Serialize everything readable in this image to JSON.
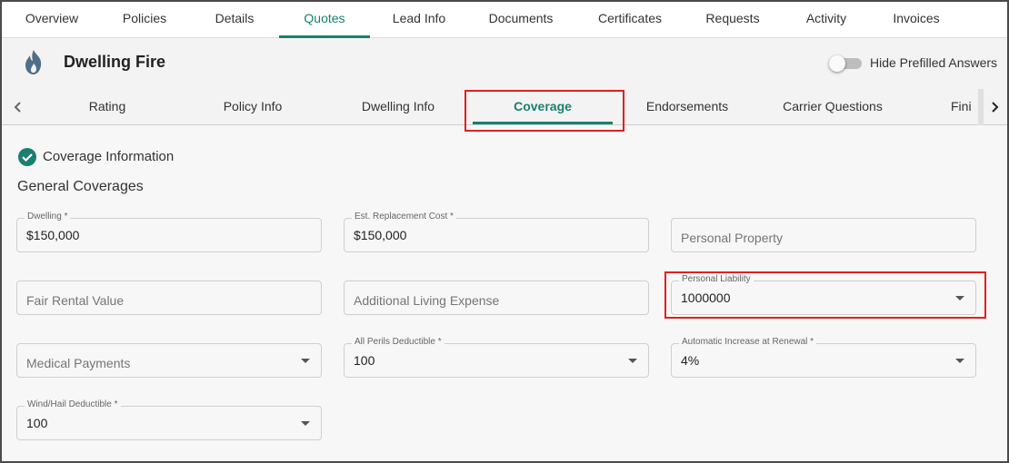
{
  "topnav": {
    "items": [
      "Overview",
      "Policies",
      "Details",
      "Quotes",
      "Lead Info",
      "Documents",
      "Certificates",
      "Requests",
      "Activity",
      "Invoices"
    ],
    "active_index": 3
  },
  "header": {
    "title": "Dwelling Fire",
    "logo_icon": "flame-icon",
    "toggle_label": "Hide Prefilled Answers",
    "toggle_on": false
  },
  "subtabs": {
    "items": [
      "Rating",
      "Policy Info",
      "Dwelling Info",
      "Coverage",
      "Endorsements",
      "Carrier Questions",
      "Fini"
    ],
    "active_index": 3,
    "prev_icon": "chevron-left-icon",
    "next_icon": "chevron-right-icon"
  },
  "section": {
    "title": "Coverage Information",
    "status_icon": "check-circle-icon",
    "group_title": "General Coverages"
  },
  "fields": {
    "dwelling": {
      "label": "Dwelling *",
      "value": "$150,000"
    },
    "est_replacement_cost": {
      "label": "Est. Replacement Cost *",
      "value": "$150,000"
    },
    "personal_property": {
      "placeholder": "Personal Property"
    },
    "fair_rental_value": {
      "placeholder": "Fair Rental Value"
    },
    "additional_living_expense": {
      "placeholder": "Additional Living Expense"
    },
    "personal_liability": {
      "label": "Personal Liability",
      "value": "1000000"
    },
    "medical_payments": {
      "placeholder": "Medical Payments"
    },
    "all_perils_deductible": {
      "label": "All Perils Deductible *",
      "value": "100"
    },
    "automatic_increase": {
      "label": "Automatic Increase at Renewal *",
      "value": "4%"
    },
    "wind_hail_deductible": {
      "label": "Wind/Hail Deductible *",
      "value": "100"
    }
  },
  "colors": {
    "accent": "#1a7f6e",
    "highlight": "#e0201f"
  }
}
